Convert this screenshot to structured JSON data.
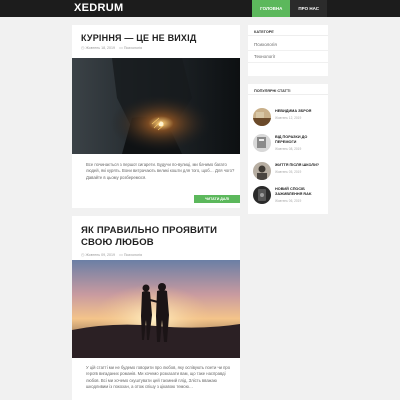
{
  "header": {
    "logo": "XEDRUM",
    "nav": [
      "ГОЛОВНА",
      "ПРО НАС"
    ]
  },
  "posts": [
    {
      "title": "КУРІННЯ — ЦЕ НЕ ВИХІД",
      "date": "Жовтень 18, 2019",
      "category": "Психологія",
      "excerpt": "Все починається з першої сигарети. Будучи по-вулиці, ми бачимо багато людей, які курять. Вони витрачають великі кошти для того, щоб… Для чого? Давайте в цьому розберемося.",
      "button": "ЧИТАТИ ДАЛІ"
    },
    {
      "title": "ЯК ПРАВИЛЬНО ПРОЯВИТИ СВОЮ ЛЮБОВ",
      "date": "Жовтень 09, 2019",
      "category": "Психологія",
      "excerpt": "У цій статті ми не будемо говорити про любов, яку оспівують поети чи про героїв вигаданих романів. Ми хочемо розказати вам, що таке насправді любов. Всі ми хочемо скуштувати цей таємний плід. Злість вважаю шкодливим із покохан, а отож спішу з цікавою темою…"
    }
  ],
  "sidebar": {
    "categories": {
      "title": "КАТЕГОРІЇ",
      "items": [
        "Психологія",
        "Технології"
      ]
    },
    "popular": {
      "title": "ПОПУЛЯРНІ СТАТТІ",
      "items": [
        {
          "title": "НЕВИДИМА ЗБРОЯ",
          "date": "Жовтень 12, 2019"
        },
        {
          "title": "ВІД ПОРАЗКИ ДО ПЕРЕМОГИ",
          "date": "Жовтень 08, 2019"
        },
        {
          "title": "ЖИТТЯ ПІСЛЯ ШКОЛИ?",
          "date": "Жовтень 05, 2019"
        },
        {
          "title": "НОВИЙ СПОСІБ ЗАЖИВЛЕННЯ RAK",
          "date": "Жовтень 06, 2019"
        }
      ]
    }
  },
  "colors": {
    "accent": "#5cb85c",
    "topbar": "#1c1c1c"
  }
}
